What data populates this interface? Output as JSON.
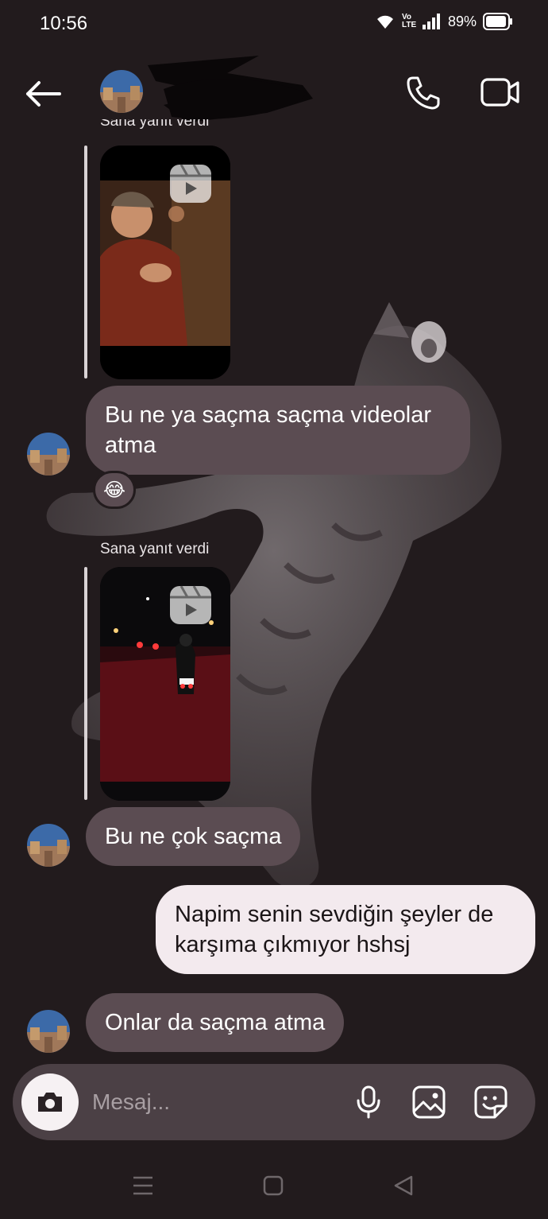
{
  "status_bar": {
    "time": "10:56",
    "network_badge": "Vo LTE",
    "battery": "89%"
  },
  "header": {
    "contact_name_hidden": true
  },
  "messages": [
    {
      "type": "reply_reel",
      "reply_label": "Sana yanıt verdi"
    },
    {
      "type": "incoming",
      "text": "Bu ne ya saçma saçma videolar atma",
      "reaction": "😂"
    },
    {
      "type": "reply_reel",
      "reply_label": "Sana yanıt verdi"
    },
    {
      "type": "incoming",
      "text": "Bu ne çok saçma"
    },
    {
      "type": "outgoing",
      "text": "Napim senin sevdiğin şeyler de karşıma çıkmıyor hshsj"
    },
    {
      "type": "incoming",
      "text": "Onlar da saçma atma"
    }
  ],
  "composer": {
    "placeholder": "Mesaj..."
  },
  "icons": {
    "back": "arrow-left-icon",
    "call": "phone-icon",
    "video": "video-camera-icon",
    "camera": "camera-icon",
    "mic": "microphone-icon",
    "gallery": "image-icon",
    "sticker": "sticker-icon",
    "reel": "reel-play-icon"
  },
  "colors": {
    "background": "#221b1d",
    "incoming_bubble": "#5b4c52",
    "outgoing_bubble": "#f3eaee",
    "composer": "#4b4045"
  }
}
